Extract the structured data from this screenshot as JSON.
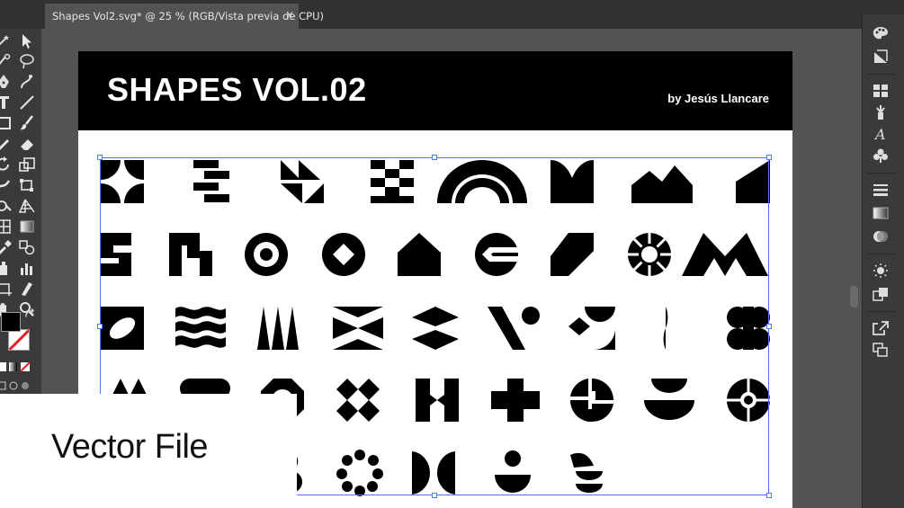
{
  "tab": {
    "title": "Shapes Vol2.svg* @ 25 % (RGB/Vista previa de CPU)",
    "close_glyph": "✕"
  },
  "artboard": {
    "title": "SHAPES VOL.02",
    "author": "by Jesús Llancare"
  },
  "badge": {
    "text": "Vector File"
  },
  "colors": {
    "selection": "#4a7bff",
    "panel": "#3a3a3a",
    "canvas": "#535353"
  },
  "left_tools": [
    "selection-tool-icon",
    "direct-selection-tool-icon",
    "magic-wand-icon",
    "lasso-icon",
    "pen-tool-icon",
    "curvature-icon",
    "type-tool-icon",
    "line-tool-icon",
    "rectangle-tool-icon",
    "paintbrush-icon",
    "pencil-icon",
    "eraser-icon",
    "rotate-tool-icon",
    "scale-tool-icon",
    "warp-tool-icon",
    "free-transform-icon",
    "shape-builder-icon",
    "perspective-grid-icon",
    "mesh-tool-icon",
    "gradient-tool-icon",
    "eyedropper-icon",
    "blend-tool-icon",
    "symbol-sprayer-icon",
    "graph-tool-icon",
    "artboard-tool-icon",
    "slice-tool-icon",
    "hand-tool-icon",
    "zoom-tool-icon"
  ],
  "right_panels": [
    "color-palette-icon",
    "color-guide-icon",
    "swatches-icon",
    "brushes-icon",
    "character-icon",
    "symbols-icon",
    "stroke-icon",
    "gradient-icon",
    "transparency-icon",
    "appearance-icon",
    "graphic-styles-icon",
    "export-icon",
    "layers-icon"
  ]
}
